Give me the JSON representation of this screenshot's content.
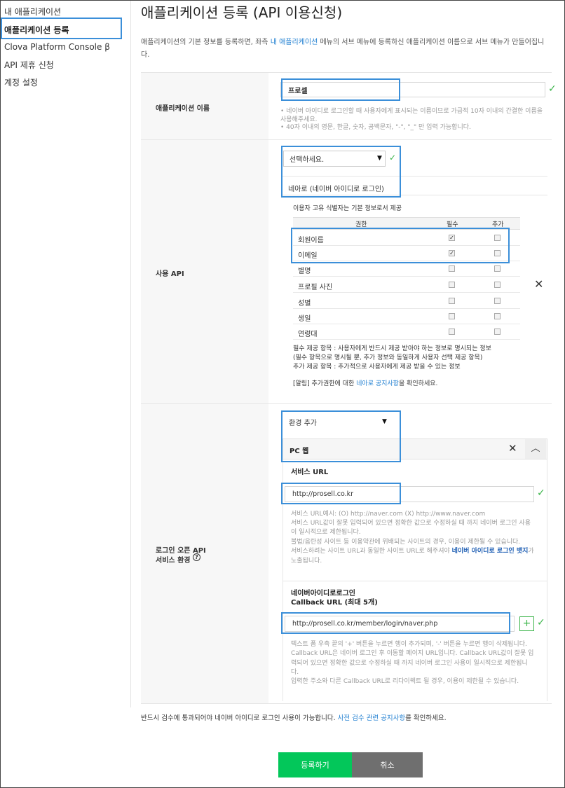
{
  "sidebar": {
    "items": [
      {
        "label": "내 애플리케이션"
      },
      {
        "label": "애플리케이션 등록"
      },
      {
        "label": "Clova Platform Console β"
      },
      {
        "label": "API 제휴 신청"
      },
      {
        "label": "계정 설정"
      }
    ]
  },
  "page": {
    "title": "애플리케이션 등록 (API 이용신청)",
    "intro_prefix": "애플리케이션의 기본 정보를 등록하면, 좌측 ",
    "intro_link": "내 애플리케이션",
    "intro_suffix": " 메뉴의 서브 메뉴에 등록하신 애플리케이션 이름으로 서브 메뉴가 만들어집니다."
  },
  "app_name": {
    "label": "애플리케이션 이름",
    "value": "프로셀",
    "help": [
      "• 네이버 아이디로 로그인할 때 사용자에게 표시되는 이름이므로 가급적 10자 이내의 간결한 이름을 사용해주세요.",
      "• 40자 이내의 영문, 한글, 숫자, 공백문자, \"-\", \"_\" 만 입력 가능합니다."
    ]
  },
  "api": {
    "label": "사용 API",
    "select_value": "선택하세요.",
    "selected_api": "네아로 (네이버 아이디로 로그인)",
    "subtitle": "이용자 고유 식별자는 기본 정보로서 제공",
    "columns": [
      "권한",
      "필수",
      "추가"
    ],
    "rows": [
      {
        "name": "회원이름",
        "required": true,
        "extra": false
      },
      {
        "name": "이메일",
        "required": true,
        "extra": false
      },
      {
        "name": "별명",
        "required": false,
        "extra": false
      },
      {
        "name": "프로필 사진",
        "required": false,
        "extra": false
      },
      {
        "name": "성별",
        "required": false,
        "extra": false
      },
      {
        "name": "생일",
        "required": false,
        "extra": false
      },
      {
        "name": "연령대",
        "required": false,
        "extra": false
      }
    ],
    "notes": [
      "필수 제공 항목 : 사용자에게 반드시 제공 받아야 하는 정보로 명시되는 정보",
      "(필수 항목으로 명시될 뿐, 추가 정보와 동일하게 사용자 선택 제공 항목)",
      "추가 제공 항목 : 추가적으로 사용자에게 제공 받을 수 있는 정보"
    ],
    "alert_prefix": "[알림] 추가권한에 대한 ",
    "alert_link": "네아로 공지사항",
    "alert_suffix": "을 확인하세요."
  },
  "env": {
    "label_line1": "로그인 오픈 API",
    "label_line2": "서비스 환경",
    "select_value": "환경 추가",
    "pc_title": "PC 웹",
    "service_url_label": "서비스 URL",
    "service_url_value": "http://prosell.co.kr",
    "service_help": [
      "서비스 URL예시: (O) http://naver.com (X) http://www.naver.com",
      "서비스 URL값이 잘못 입력되어 있으면 정확한 값으로 수정하실 때 까지 네이버 로그인 사용",
      "이 일시적으로 제한됩니다.",
      "불법/음란성 사이트 등 이용약관에 위배되는 사이트의 경우, 이용이 제한될 수 있습니다.",
      "서비스하려는 사이트 URL과 동일한 사이트 URL로 해주셔야 ",
      "노출됩니다."
    ],
    "service_help_link": "네이버 아이디로 로그인 뱃지",
    "service_help_after_link": "가",
    "callback_label_line1": "네이버아이디로로그인",
    "callback_label_line2": "Callback URL (최대 5개)",
    "callback_value": "http://prosell.co.kr/member/login/naver.php",
    "callback_help": [
      "텍스트 폼 우측 끝의 '+' 버튼을 누르면 행이 추가되며, '-' 버튼을 누르면 행이 삭제됩니다.",
      "Callback URL은 네이버 로그인 후 이동할 페이지 URL입니다. Callback URL값이 잘못 입",
      "력되어 있으면 정확한 값으로 수정하실 때 까지 네이버 로그인 사용이 일시적으로 제한됩니",
      "다.",
      "입력한 주소와 다른 Callback URL로 리다이렉트 될 경우, 이용이 제한될 수 있습니다."
    ]
  },
  "footer": {
    "notice_prefix": "반드시 검수에 통과되어야 네이버 아이디로 로그인 사용이 가능합니다. ",
    "notice_link": "사전 검수 관련 공지사항",
    "notice_suffix": "를 확인하세요.",
    "register_label": "등록하기",
    "cancel_label": "취소"
  },
  "colors": {
    "accent_green": "#03c75a",
    "cancel_gray": "#6f6f6f",
    "highlight_blue": "#3b8fd9",
    "link_blue": "#1f7fd1"
  }
}
